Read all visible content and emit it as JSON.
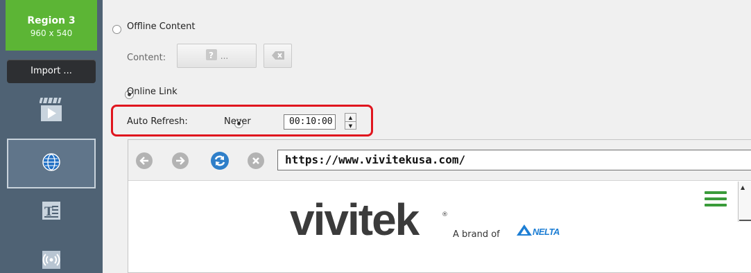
{
  "region": {
    "title": "Region 3",
    "size": "960 x 540"
  },
  "import_label": "Import ...",
  "sidebar": {
    "items": [
      {
        "icon": "video-clapper-icon"
      },
      {
        "icon": "globe-icon",
        "active": true
      },
      {
        "icon": "text-icon"
      },
      {
        "icon": "broadcast-icon"
      }
    ]
  },
  "offline": {
    "label": "Offline Content",
    "selected": false,
    "content_label": "Content:",
    "browse_label": "...",
    "clear_icon": "clear-icon"
  },
  "online": {
    "label": "Online Link",
    "selected": true
  },
  "auto_refresh": {
    "label": "Auto Refresh:",
    "never_label": "Never",
    "never_selected": true,
    "interval_value": "00:10:00"
  },
  "browser": {
    "url": "https://www.vivitekusa.com/",
    "logo_text": "vivitek",
    "logo_reg": "®",
    "brand_of": "A brand of",
    "delta_text": "NELTA",
    "colors": {
      "nav_grey": "#b3b3b3",
      "refresh_blue": "#2f7fc9",
      "hamburger_green": "#3a9b3a",
      "delta_blue": "#1d7ed4"
    }
  },
  "colors": {
    "sidebar_bg": "#4f6274",
    "region_green": "#5cb535",
    "highlight_red": "#e0151e"
  }
}
